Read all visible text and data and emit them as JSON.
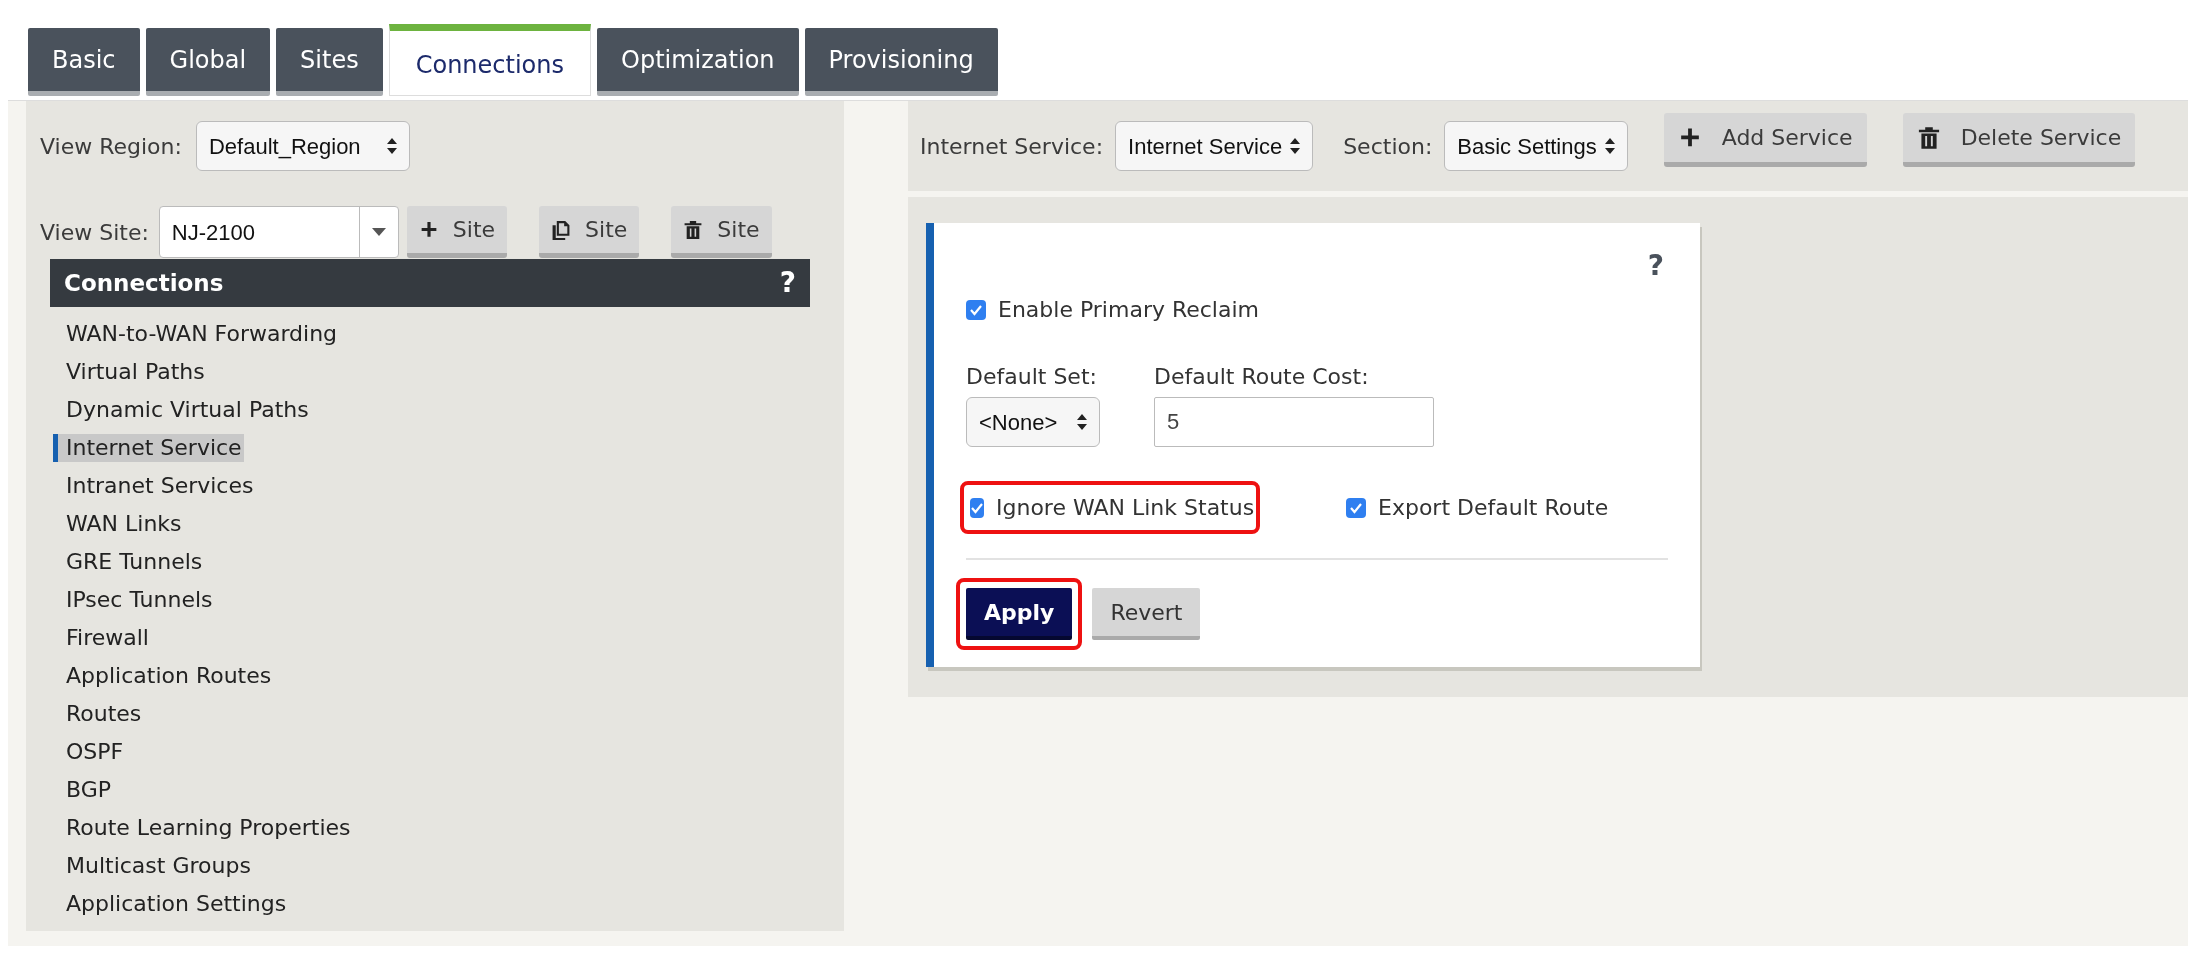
{
  "tabs": [
    {
      "label": "Basic",
      "selected": false
    },
    {
      "label": "Global",
      "selected": false
    },
    {
      "label": "Sites",
      "selected": false
    },
    {
      "label": "Connections",
      "selected": true
    },
    {
      "label": "Optimization",
      "selected": false
    },
    {
      "label": "Provisioning",
      "selected": false
    }
  ],
  "sidebar": {
    "view_region": {
      "label": "View Region:",
      "value": "Default_Region"
    },
    "view_site": {
      "label": "View Site:",
      "value": "NJ-2100"
    },
    "site_buttons": [
      {
        "kind": "add",
        "label": "Site"
      },
      {
        "kind": "copy",
        "label": "Site"
      },
      {
        "kind": "delete",
        "label": "Site"
      }
    ],
    "header": {
      "title": "Connections",
      "help": "?"
    },
    "items": [
      {
        "label": "WAN-to-WAN Forwarding",
        "selected": false
      },
      {
        "label": "Virtual Paths",
        "selected": false
      },
      {
        "label": "Dynamic Virtual Paths",
        "selected": false
      },
      {
        "label": "Internet Service",
        "selected": true
      },
      {
        "label": "Intranet Services",
        "selected": false
      },
      {
        "label": "WAN Links",
        "selected": false
      },
      {
        "label": "GRE Tunnels",
        "selected": false
      },
      {
        "label": "IPsec Tunnels",
        "selected": false
      },
      {
        "label": "Firewall",
        "selected": false
      },
      {
        "label": "Application Routes",
        "selected": false
      },
      {
        "label": "Routes",
        "selected": false
      },
      {
        "label": "OSPF",
        "selected": false
      },
      {
        "label": "BGP",
        "selected": false
      },
      {
        "label": "Route Learning Properties",
        "selected": false
      },
      {
        "label": "Multicast Groups",
        "selected": false
      },
      {
        "label": "Application Settings",
        "selected": false
      }
    ]
  },
  "toolbar": {
    "service": {
      "label": "Internet Service:",
      "value": "Internet Service"
    },
    "section": {
      "label": "Section:",
      "value": "Basic Settings"
    },
    "buttons": [
      {
        "kind": "add",
        "label": "Add Service"
      },
      {
        "kind": "delete",
        "label": "Delete Service"
      }
    ]
  },
  "form": {
    "help": "?",
    "enable_primary_reclaim": {
      "label": "Enable Primary Reclaim",
      "checked": true
    },
    "default_set": {
      "label": "Default Set:",
      "value": "<None>"
    },
    "default_route_cost": {
      "label": "Default Route Cost:",
      "value": "5"
    },
    "options": [
      {
        "label": "Ignore WAN Link Status",
        "checked": true,
        "highlighted": true
      },
      {
        "label": "Export Default Route",
        "checked": true
      }
    ],
    "buttons": [
      {
        "kind": "primary",
        "label": "Apply",
        "highlighted": true
      },
      {
        "kind": "secondary",
        "label": "Revert"
      }
    ]
  }
}
